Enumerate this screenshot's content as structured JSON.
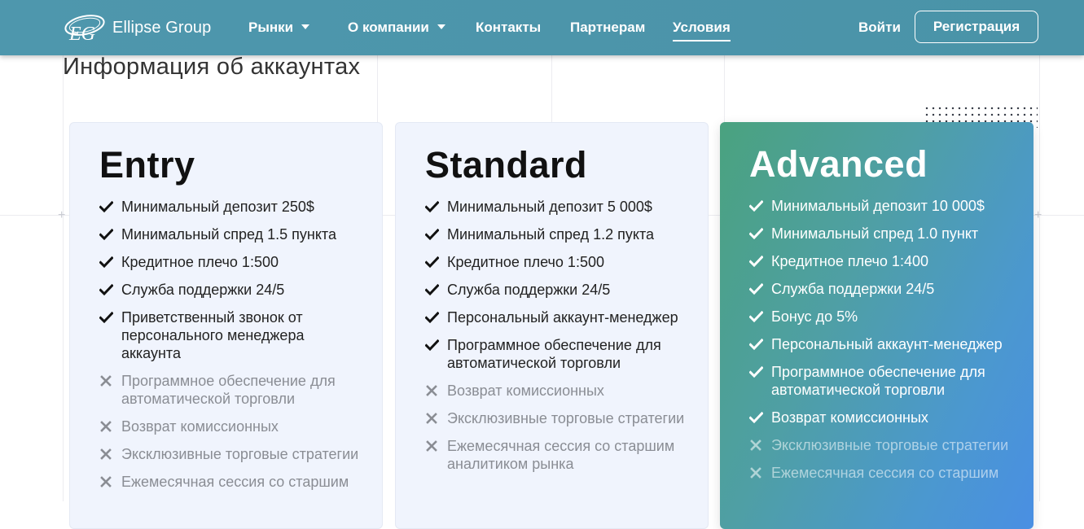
{
  "header": {
    "brand": "Ellipse Group",
    "logo_letters": "EG",
    "nav": [
      {
        "label": "Рынки",
        "has_dropdown": true
      },
      {
        "label": "О компании",
        "has_dropdown": true
      },
      {
        "label": "Контакты",
        "has_dropdown": false
      },
      {
        "label": "Партнерам",
        "has_dropdown": false
      },
      {
        "label": "Условия",
        "has_dropdown": false,
        "active": true
      }
    ],
    "login_label": "Войти",
    "register_label": "Регистрация"
  },
  "page": {
    "title": "Информация об аккаунтах"
  },
  "plans": [
    {
      "name": "Entry",
      "style": "light",
      "features": [
        {
          "text": "Минимальный депозит 250$",
          "included": true
        },
        {
          "text": "Минимальный спред 1.5 пункта",
          "included": true
        },
        {
          "text": "Кредитное плечо 1:500",
          "included": true
        },
        {
          "text": "Служба поддержки 24/5",
          "included": true
        },
        {
          "text": "Приветственный звонок от персонального менеджера аккаунта",
          "included": true
        },
        {
          "text": "Программное обеспечение для автоматической торговли",
          "included": false
        },
        {
          "text": "Возврат комиссионных",
          "included": false
        },
        {
          "text": "Эксклюзивные торговые стратегии",
          "included": false
        },
        {
          "text": "Ежемесячная сессия со старшим",
          "included": false
        }
      ]
    },
    {
      "name": "Standard",
      "style": "light",
      "features": [
        {
          "text": "Минимальный депозит 5 000$",
          "included": true
        },
        {
          "text": "Минимальный спред 1.2 пукта",
          "included": true
        },
        {
          "text": "Кредитное плечо 1:500",
          "included": true
        },
        {
          "text": "Служба поддержки 24/5",
          "included": true
        },
        {
          "text": "Персональный аккаунт-менеджер",
          "included": true
        },
        {
          "text": "Программное обеспечение для автоматической торговли",
          "included": true
        },
        {
          "text": "Возврат комиссионных",
          "included": false
        },
        {
          "text": "Эксклюзивные торговые стратегии",
          "included": false
        },
        {
          "text": "Ежемесячная сессия со старшим аналитиком рынка",
          "included": false
        }
      ]
    },
    {
      "name": "Advanced",
      "style": "dark",
      "features": [
        {
          "text": "Минимальный депозит 10 000$",
          "included": true
        },
        {
          "text": "Минимальный спред 1.0 пункт",
          "included": true
        },
        {
          "text": "Кредитное плечо 1:400",
          "included": true
        },
        {
          "text": "Служба поддержки 24/5",
          "included": true
        },
        {
          "text": "Бонус до 5%",
          "included": true
        },
        {
          "text": "Персональный аккаунт-менеджер",
          "included": true
        },
        {
          "text": "Программное обеспечение для автоматической торговли",
          "included": true
        },
        {
          "text": "Возврат комиссионных",
          "included": true
        },
        {
          "text": "Эксклюзивные торговые стратегии",
          "included": false
        },
        {
          "text": "Ежемесячная сессия со старшим",
          "included": false
        }
      ]
    }
  ],
  "icons": {
    "included": "check-icon",
    "excluded": "cross-icon"
  },
  "colors": {
    "header": "#4e97ad",
    "card_light": "#f0f4fd",
    "card_dark_start": "#4aa27f",
    "card_dark_end": "#4a8fe3"
  }
}
